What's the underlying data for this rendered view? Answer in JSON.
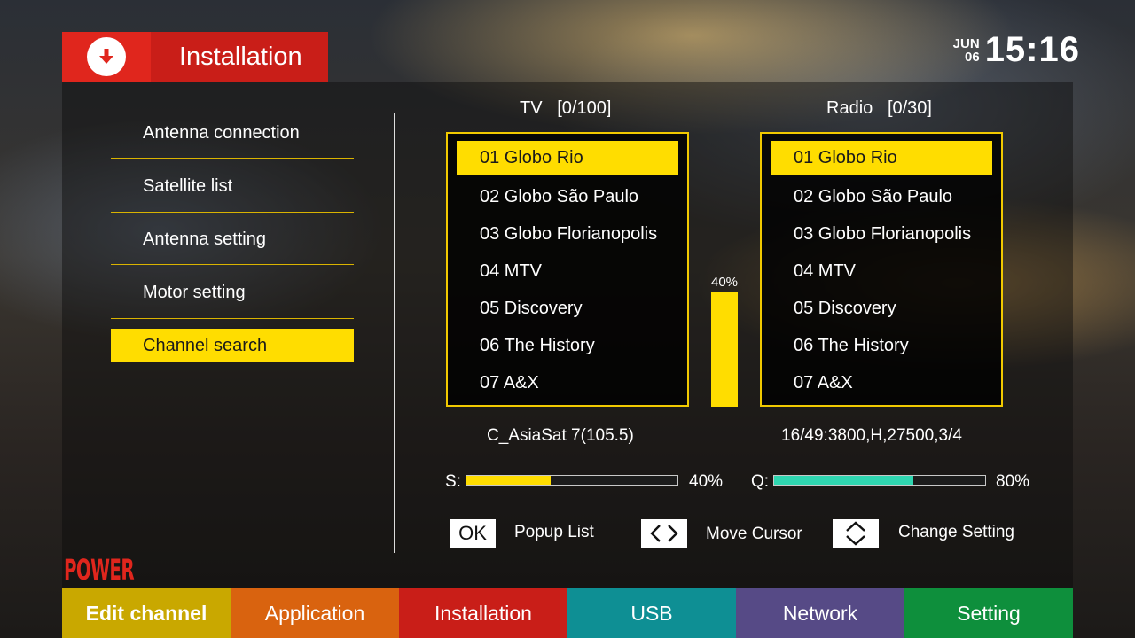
{
  "header": {
    "title": "Installation",
    "icon": "download-icon"
  },
  "clock": {
    "month": "JUN",
    "day": "06",
    "time": "15:16"
  },
  "menu": {
    "items": [
      {
        "label": "Antenna connection",
        "active": false
      },
      {
        "label": "Satellite list",
        "active": false
      },
      {
        "label": "Antenna setting",
        "active": false
      },
      {
        "label": "Motor setting",
        "active": false
      },
      {
        "label": "Channel search",
        "active": true
      }
    ]
  },
  "tv": {
    "label": "TV",
    "count": "[0/100]",
    "channels": [
      "01  Globo Rio",
      "02 Globo São Paulo",
      "03 Globo Florianopolis",
      "04 MTV",
      "05 Discovery",
      "06 The History",
      "07 A&X"
    ]
  },
  "radio": {
    "label": "Radio",
    "count": "[0/30]",
    "channels": [
      "01  Globo Rio",
      "02 Globo São Paulo",
      "03 Globo Florianopolis",
      "04 MTV",
      "05 Discovery",
      "06 The History",
      "07 A&X"
    ]
  },
  "progress": {
    "label": "40%",
    "value": 40
  },
  "satellite": "C_AsiaSat 7(105.5)",
  "transponder": "16/49:3800,H,27500,3/4",
  "signal": {
    "strength_label": "S:",
    "strength_text": "40%",
    "strength_value": 40,
    "strength_color": "#ffdd00",
    "quality_label": "Q:",
    "quality_text": "80%",
    "quality_value": 66,
    "quality_color": "#2fd6b0"
  },
  "hints": {
    "ok_key": "OK",
    "ok_text": "Popup List",
    "lr_key_icon": "left-right-arrows-icon",
    "lr_text": "Move Cursor",
    "ud_key_icon": "up-down-arrows-icon",
    "ud_text": "Change Setting"
  },
  "brand": "POWER",
  "nav": {
    "tabs": [
      {
        "label": "Edit channel",
        "color": "#c9a800"
      },
      {
        "label": "Application",
        "color": "#d9630f"
      },
      {
        "label": "Installation",
        "color": "#c91e18"
      },
      {
        "label": "USB",
        "color": "#0e8f94"
      },
      {
        "label": "Network",
        "color": "#564a86"
      },
      {
        "label": "Setting",
        "color": "#0e8f3c"
      }
    ]
  }
}
